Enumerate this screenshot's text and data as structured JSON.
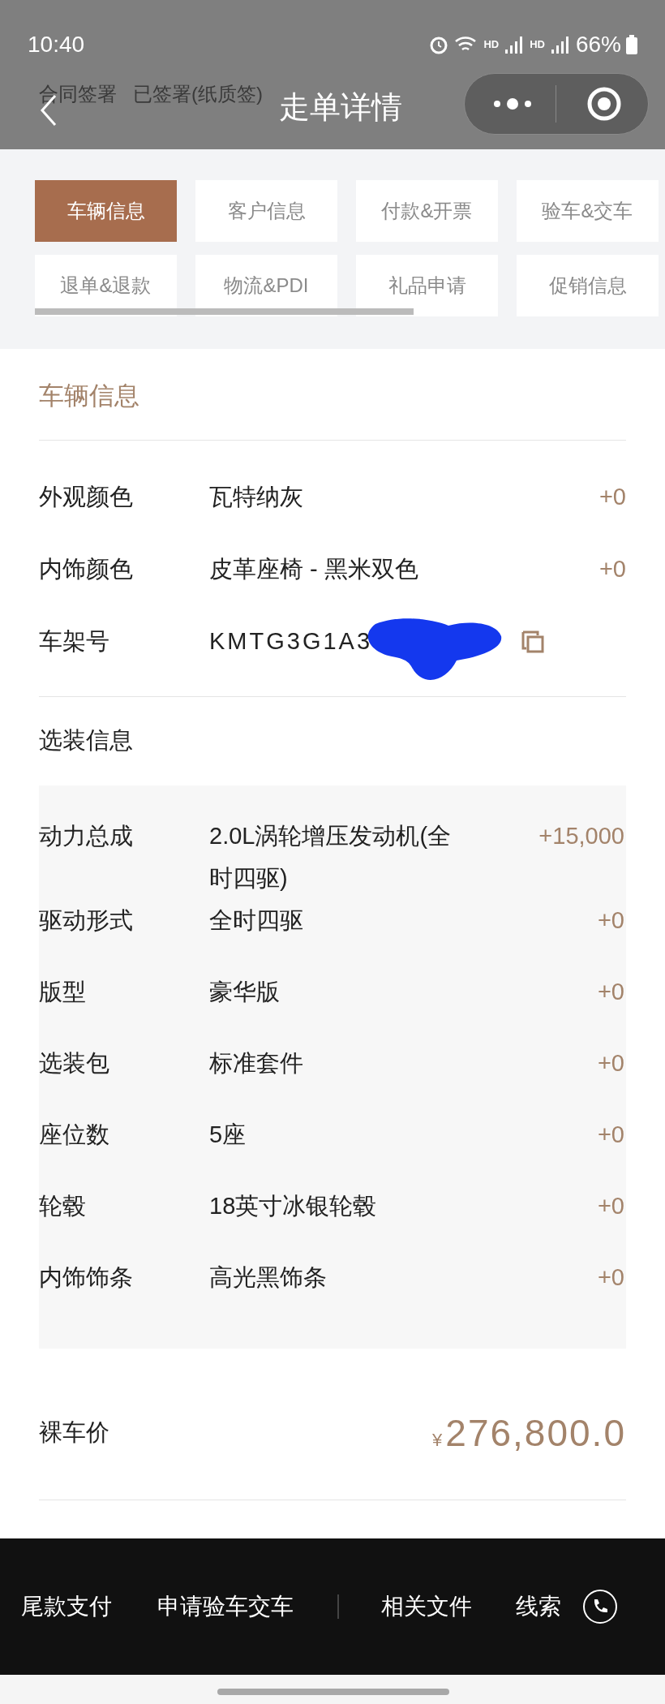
{
  "status_bar": {
    "time": "10:40",
    "network_1": "HD",
    "network_2": "HD",
    "battery": "66%"
  },
  "background_row": {
    "label": "合同签署",
    "value": "已签署(纸质签)"
  },
  "nav": {
    "title": "走单详情"
  },
  "tabs": [
    {
      "label": "车辆信息",
      "selected": true
    },
    {
      "label": "客户信息",
      "selected": false
    },
    {
      "label": "付款&开票",
      "selected": false
    },
    {
      "label": "验车&交车",
      "selected": false
    },
    {
      "label": "退单&退款",
      "selected": false
    },
    {
      "label": "物流&PDI",
      "selected": false
    },
    {
      "label": "礼品申请",
      "selected": false
    },
    {
      "label": "促销信息",
      "selected": false
    }
  ],
  "section_title": "车辆信息",
  "basic_rows": [
    {
      "label": "外观颜色",
      "value": "瓦特纳灰",
      "price": "+0",
      "kind": "plain"
    },
    {
      "label": "内饰颜色",
      "value": "皮革座椅 - 黑米双色",
      "price": "+0",
      "kind": "plain"
    },
    {
      "label": "车架号",
      "value": "KMTG3G1A3",
      "kind": "vin"
    }
  ],
  "options_title": "选装信息",
  "option_rows": [
    {
      "label": "动力总成",
      "value": "2.0L涡轮增压发动机(全时四驱)",
      "price": "+15,000"
    },
    {
      "label": "驱动形式",
      "value": "全时四驱",
      "price": "+0"
    },
    {
      "label": "版型",
      "value": "豪华版",
      "price": "+0"
    },
    {
      "label": "选装包",
      "value": "标准套件",
      "price": "+0"
    },
    {
      "label": "座位数",
      "value": "5座",
      "price": "+0"
    },
    {
      "label": "轮毂",
      "value": "18英寸冰银轮毂",
      "price": "+0"
    },
    {
      "label": "内饰饰条",
      "value": "高光黑饰条",
      "price": "+0"
    }
  ],
  "total": {
    "label": "裸车价",
    "currency": "¥",
    "amount": "276,800.0"
  },
  "bottom_bar": [
    "尾款支付",
    "申请验车交车",
    "相关文件",
    "线索"
  ]
}
